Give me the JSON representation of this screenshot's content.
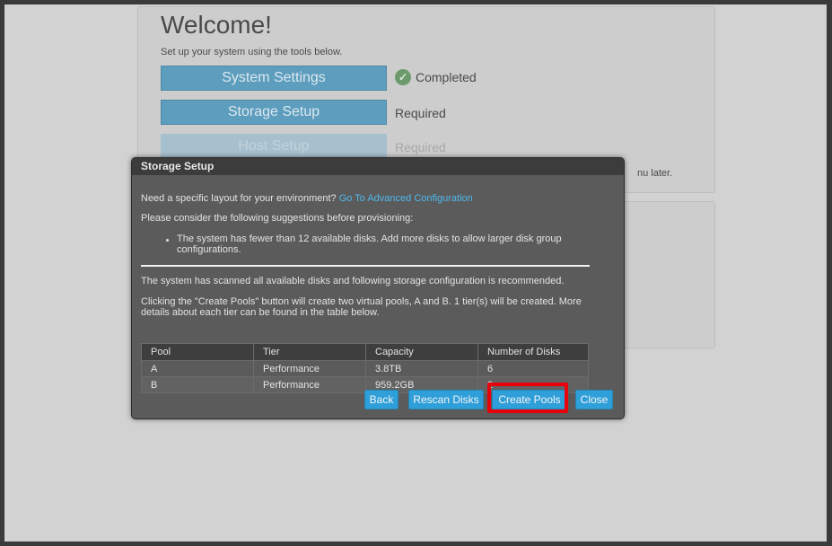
{
  "welcome": {
    "title": "Welcome!",
    "subtitle": "Set up your system using the tools below.",
    "steps": [
      {
        "label": "System Settings",
        "status": "Completed"
      },
      {
        "label": "Storage Setup",
        "status": "Required"
      },
      {
        "label": "Host Setup",
        "status": "Required"
      }
    ],
    "partial_note": "nu later."
  },
  "dialog": {
    "title": "Storage Setup",
    "layout_question": "Need a specific layout for your environment?",
    "advanced_link": "Go To Advanced Configuration",
    "consider": "Please consider the following suggestions before provisioning:",
    "suggestion": "The system has fewer than 12 available disks. Add more disks to allow larger disk group configurations.",
    "scanned": "The system has scanned all available disks and following storage configuration is recommended.",
    "create_info": "Clicking the \"Create Pools\" button will create two virtual pools, A and B. 1 tier(s) will be created. More details about each tier can be found in the table below.",
    "table": {
      "headers": [
        "Pool",
        "Tier",
        "Capacity",
        "Number of Disks"
      ],
      "rows": [
        [
          "A",
          "Performance",
          "3.8TB",
          "6"
        ],
        [
          "B",
          "Performance",
          "959.2GB",
          "2"
        ]
      ]
    },
    "buttons": {
      "back": "Back",
      "rescan": "Rescan Disks",
      "create": "Create Pools",
      "close": "Close"
    }
  },
  "colors": {
    "accent": "#2f9fd9",
    "highlight": "#e8000b",
    "link": "#4fb8ee"
  }
}
